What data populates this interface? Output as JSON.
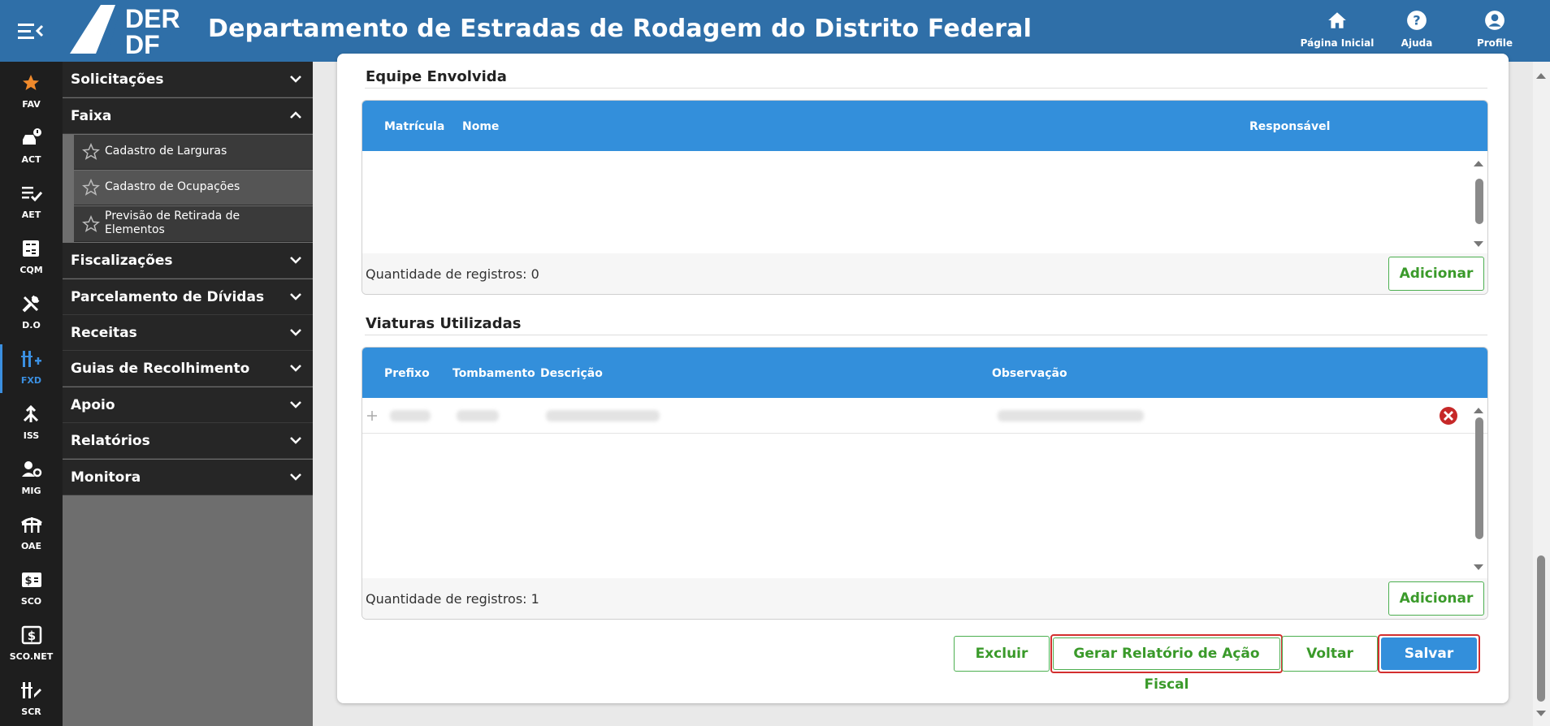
{
  "header": {
    "logo_text_top": "DER",
    "logo_text_bottom": "DF",
    "title": "Departamento de Estradas de Rodagem do Distrito Federal",
    "home_label": "Página Inicial",
    "help_label": "Ajuda",
    "profile_label": "Profile"
  },
  "rail": {
    "items": [
      {
        "label": "FAV",
        "icon": "star-icon"
      },
      {
        "label": "ACT",
        "icon": "car-alert-icon"
      },
      {
        "label": "AET",
        "icon": "list-check-icon"
      },
      {
        "label": "CQM",
        "icon": "calculator-icon"
      },
      {
        "label": "D.O",
        "icon": "tools-icon"
      },
      {
        "label": "FXD",
        "icon": "ruler-plus-icon"
      },
      {
        "label": "ISS",
        "icon": "merge-icon"
      },
      {
        "label": "MIG",
        "icon": "user-gear-icon"
      },
      {
        "label": "OAE",
        "icon": "bridge-icon"
      },
      {
        "label": "SCO",
        "icon": "dollar-card-icon"
      },
      {
        "label": "SCO.NET",
        "icon": "dollar-box-icon"
      },
      {
        "label": "SCR",
        "icon": "ruler-pen-icon"
      }
    ]
  },
  "menu": {
    "solicitacoes": "Solicitações",
    "faixa": "Faixa",
    "cadastro_larguras": "Cadastro de Larguras",
    "cadastro_ocupacoes": "Cadastro de Ocupações",
    "previsao_retirada": "Previsão de Retirada de Elementos",
    "fiscalizacoes": "Fiscalizações",
    "parcelamento": "Parcelamento de Dívidas",
    "receitas": "Receitas",
    "guias": "Guias de Recolhimento",
    "apoio": "Apoio",
    "relatorios": "Relatórios",
    "monitora": "Monitora"
  },
  "equipe": {
    "title": "Equipe Envolvida",
    "col_matricula": "Matrícula",
    "col_nome": "Nome",
    "col_responsavel": "Responsável",
    "count": "Quantidade de registros: 0",
    "add_label": "Adicionar"
  },
  "viaturas": {
    "title": "Viaturas Utilizadas",
    "col_prefixo": "Prefixo",
    "col_tombamento": "Tombamento",
    "col_descricao": "Descrição",
    "col_observacao": "Observação",
    "count": "Quantidade de registros: 1",
    "add_label": "Adicionar"
  },
  "actions": {
    "excluir": "Excluir",
    "gerar": "Gerar Relatório de Ação Fiscal",
    "voltar": "Voltar",
    "salvar": "Salvar"
  },
  "colors": {
    "header": "#2f6fa8",
    "grid_head": "#338fdb",
    "accent_green": "#3a9a2a",
    "highlight_red": "#d32f2f"
  }
}
